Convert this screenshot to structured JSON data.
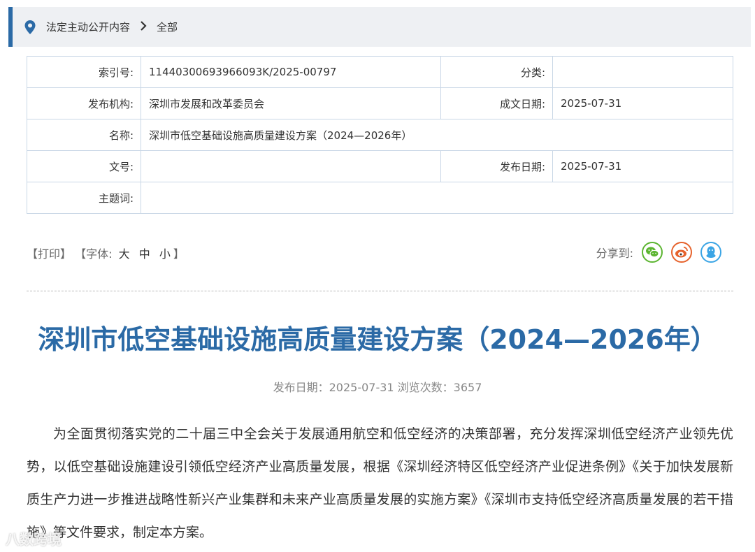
{
  "breadcrumb": {
    "items": [
      "法定主动公开内容",
      "全部"
    ],
    "separator": ">"
  },
  "meta": {
    "index_label": "索引号:",
    "index_value": "11440300693966093K/2025-00797",
    "category_label": "分类:",
    "category_value": "",
    "publisher_label": "发布机构:",
    "publisher_value": "深圳市发展和改革委员会",
    "created_label": "成文日期:",
    "created_value": "2025-07-31",
    "name_label": "名称:",
    "name_value": "深圳市低空基础设施高质量建设方案（2024—2026年）",
    "docno_label": "文号:",
    "docno_value": "",
    "published_label": "发布日期:",
    "published_value": "2025-07-31",
    "subject_label": "主题词:",
    "subject_value": ""
  },
  "tools": {
    "print": "【打印】",
    "font_prefix": "【字体:",
    "large": "大",
    "medium": "中",
    "small": "小",
    "font_suffix": "】"
  },
  "share": {
    "label": "分享到:",
    "icons": [
      "wechat-icon",
      "weibo-icon",
      "qq-icon"
    ],
    "colors": {
      "wechat": "#5cb531",
      "weibo": "#e6632d",
      "qq": "#3ba5e5"
    }
  },
  "article": {
    "title": "深圳市低空基础设施高质量建设方案（2024—2026年）",
    "date_line": "发布日期：2025-07-31  浏览次数：3657",
    "paragraph": "为全面贯彻落实党的二十届三中全会关于发展通用航空和低空经济的决策部署，充分发挥深圳低空经济产业领先优势，以低空基础设施建设引领低空经济产业高质量发展，根据《深圳经济特区低空经济产业促进条例》《关于加快发展新质生产力进一步推进战略性新兴产业集群和未来产业高质量发展的实施方案》《深圳市支持低空经济高质量发展的若干措施》等文件要求，制定本方案。"
  },
  "colors": {
    "accent": "#2b6aa6",
    "border": "#c9d7e6"
  },
  "watermark": "八数跨境"
}
